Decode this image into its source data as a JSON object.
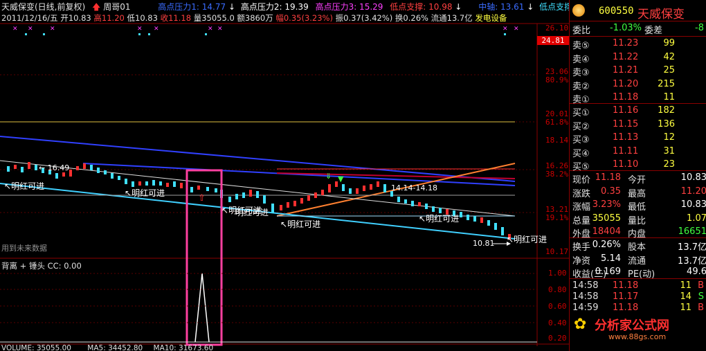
{
  "header": {
    "stock_title": "天威保变(日线,前复权)",
    "indicator_name": "周哥01",
    "sup1": "高点压力1: 14.77",
    "sup2": "高点压力2: 19.39",
    "sup3": "高点压力3: 15.29",
    "low_support": "低点支撑: 10.98",
    "mid": "中轴: 13.61",
    "low_support2": "低点支撑",
    "date": "2011/12/16/五",
    "open": "开10.83",
    "high": "高11.20",
    "low": "低10.83",
    "close": "收11.18",
    "volume": "量35055.0",
    "amount": "额3860万",
    "change": "幅0.35(3.23%)",
    "amplitude": "振0.37(3.42%)",
    "turnover": "换0.26%",
    "float": "流通13.7亿",
    "industry": "发电设备"
  },
  "price_axis": [
    "26.10",
    "23.06",
    "80.9%",
    "20.01",
    "61.8%",
    "18.14",
    "16.26",
    "38.2%",
    "13.21",
    "19.1%",
    "10.17"
  ],
  "current_price_tag": "24.81",
  "annotations": {
    "peak": "16.49",
    "buy1": "明红可进",
    "buy2": "明红可进",
    "buy3": "明红可进",
    "buy4": "明红可进",
    "buy5": "明红可进",
    "buy6": "明红可进",
    "range": "14.14-14.18",
    "low_label": "10.81",
    "future_data": "用到未来数据"
  },
  "sub_panel": {
    "title": "背离 + 锤头  CC: 0.00",
    "axis": [
      "1.00",
      "0.80",
      "0.60",
      "0.40",
      "0.20"
    ]
  },
  "volume_bar": {
    "volume": "VOLUME: 35055.00",
    "ma5": "MA5: 34452.80",
    "ma10": "MA10: 31673.60"
  },
  "side": {
    "code": "600550",
    "name": "天威保变",
    "weibi_label": "委比",
    "weibi_value": "-1.03%",
    "weicha_label": "委差",
    "weicha_value": "-8",
    "asks": [
      {
        "label": "卖⑤",
        "price": "11.23",
        "vol": "99"
      },
      {
        "label": "卖④",
        "price": "11.22",
        "vol": "42"
      },
      {
        "label": "卖③",
        "price": "11.21",
        "vol": "25"
      },
      {
        "label": "卖②",
        "price": "11.20",
        "vol": "215"
      },
      {
        "label": "卖①",
        "price": "11.18",
        "vol": "11"
      }
    ],
    "bids": [
      {
        "label": "买①",
        "price": "11.16",
        "vol": "182"
      },
      {
        "label": "买②",
        "price": "11.15",
        "vol": "136"
      },
      {
        "label": "买③",
        "price": "11.13",
        "vol": "12"
      },
      {
        "label": "买④",
        "price": "11.11",
        "vol": "31"
      },
      {
        "label": "买⑤",
        "price": "11.10",
        "vol": "23"
      }
    ],
    "stats": [
      {
        "l1": "现价",
        "v1": "11.18",
        "l2": "今开",
        "v2": "10.83"
      },
      {
        "l1": "涨跌",
        "v1": "0.35",
        "l2": "最高",
        "v2": "11.20"
      },
      {
        "l1": "涨幅",
        "v1": "3.23%",
        "l2": "最低",
        "v2": "10.83"
      },
      {
        "l1": "总量",
        "v1": "35055",
        "l2": "量比",
        "v2": "1.07"
      },
      {
        "l1": "外盘",
        "v1": "18404",
        "l2": "内盘",
        "v2": "16651"
      }
    ],
    "stats2": [
      {
        "l1": "换手",
        "v1": "0.26%",
        "l2": "股本",
        "v2": "13.7亿"
      },
      {
        "l1": "净资",
        "v1": "5.14",
        "l2": "流通",
        "v2": "13.7亿"
      },
      {
        "l1": "收益(三)",
        "v1": "0.169",
        "l2": "PE(动)",
        "v2": "49.6"
      }
    ],
    "ticks": [
      {
        "time": "14:58",
        "price": "11.18",
        "vol": "11",
        "flag": "B"
      },
      {
        "time": "14:58",
        "price": "11.17",
        "vol": "14",
        "flag": "S"
      },
      {
        "time": "14:59",
        "price": "11.18",
        "vol": "11",
        "flag": "B"
      }
    ],
    "watermark": "分析家公式网",
    "watermark_url": "www.88gs.com"
  }
}
